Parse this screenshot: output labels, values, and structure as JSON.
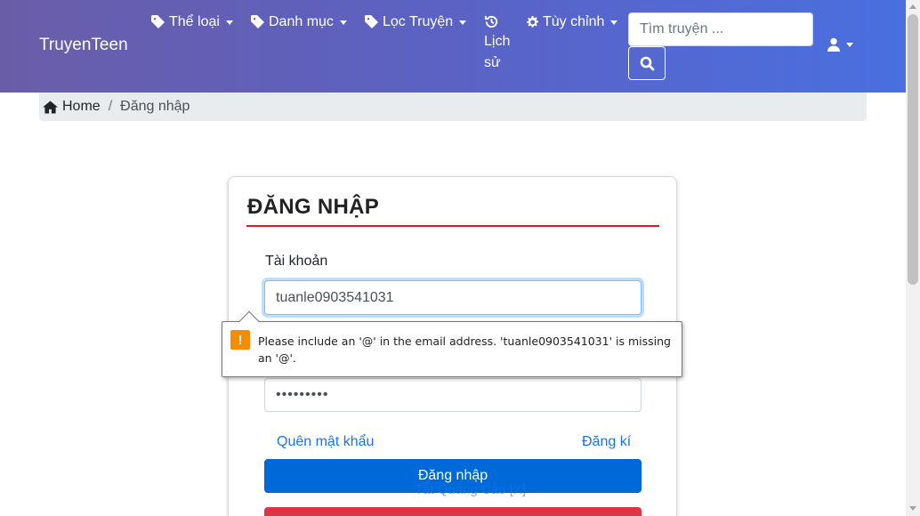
{
  "navbar": {
    "brand": "TruyenTeen",
    "items": [
      {
        "label": "Thể loại",
        "icon": "tag-icon"
      },
      {
        "label": "Danh mục",
        "icon": "tag-icon"
      },
      {
        "label": "Lọc Truyện",
        "icon": "tag-icon"
      }
    ],
    "history_line1": "Lịch",
    "history_line2": "sử",
    "customize_label": "Tùy chỉnh",
    "search_placeholder": "Tìm truyện ...",
    "colors": {
      "gradient_start": "#6a5da8",
      "gradient_end": "#4a6fe0"
    }
  },
  "breadcrumb": {
    "home": "Home",
    "separator": "/",
    "current": "Đăng nhập"
  },
  "login": {
    "title": "ĐĂNG NHẬP",
    "username_label": "Tài khoản",
    "username_value": "tuanle0903541031",
    "password_value": "•••••••••",
    "forgot_link": "Quên mật khẩu",
    "register_link": "Đăng kí",
    "login_button": "Đăng nhập",
    "ad_link": "Tắt Quảng Cáo [X]",
    "colors": {
      "title_rule": "#d32027",
      "primary": "#0069d9",
      "danger": "#dc3545",
      "link": "#1a73e8"
    }
  },
  "validation": {
    "icon": "warning-icon",
    "icon_glyph": "!",
    "message": "Please include an '@' in the email address. 'tuanle0903541031' is missing an '@'.",
    "color": "#f48c06"
  }
}
